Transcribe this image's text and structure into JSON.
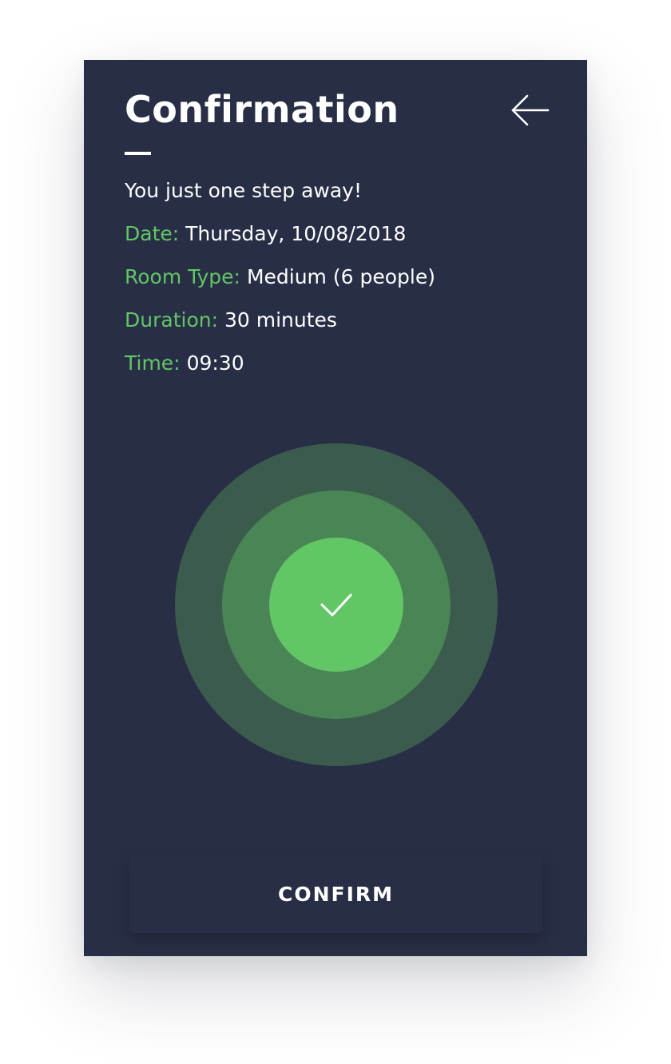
{
  "header": {
    "title": "Confirmation"
  },
  "subtitle": "You just one step away!",
  "details": [
    {
      "label": "Date:",
      "value": "Thursday, 10/08/2018"
    },
    {
      "label": "Room Type:",
      "value": "Medium (6 people)"
    },
    {
      "label": "Duration:",
      "value": "30 minutes"
    },
    {
      "label": "Time:",
      "value": "09:30"
    }
  ],
  "status": {
    "icon": "check-icon"
  },
  "footer": {
    "confirm_label": "CONFIRM"
  },
  "colors": {
    "background": "#282e45",
    "accent_green": "#62c666",
    "ring_middle": "#4a8556",
    "ring_outer": "#3b5c4d",
    "text": "#ffffff"
  }
}
